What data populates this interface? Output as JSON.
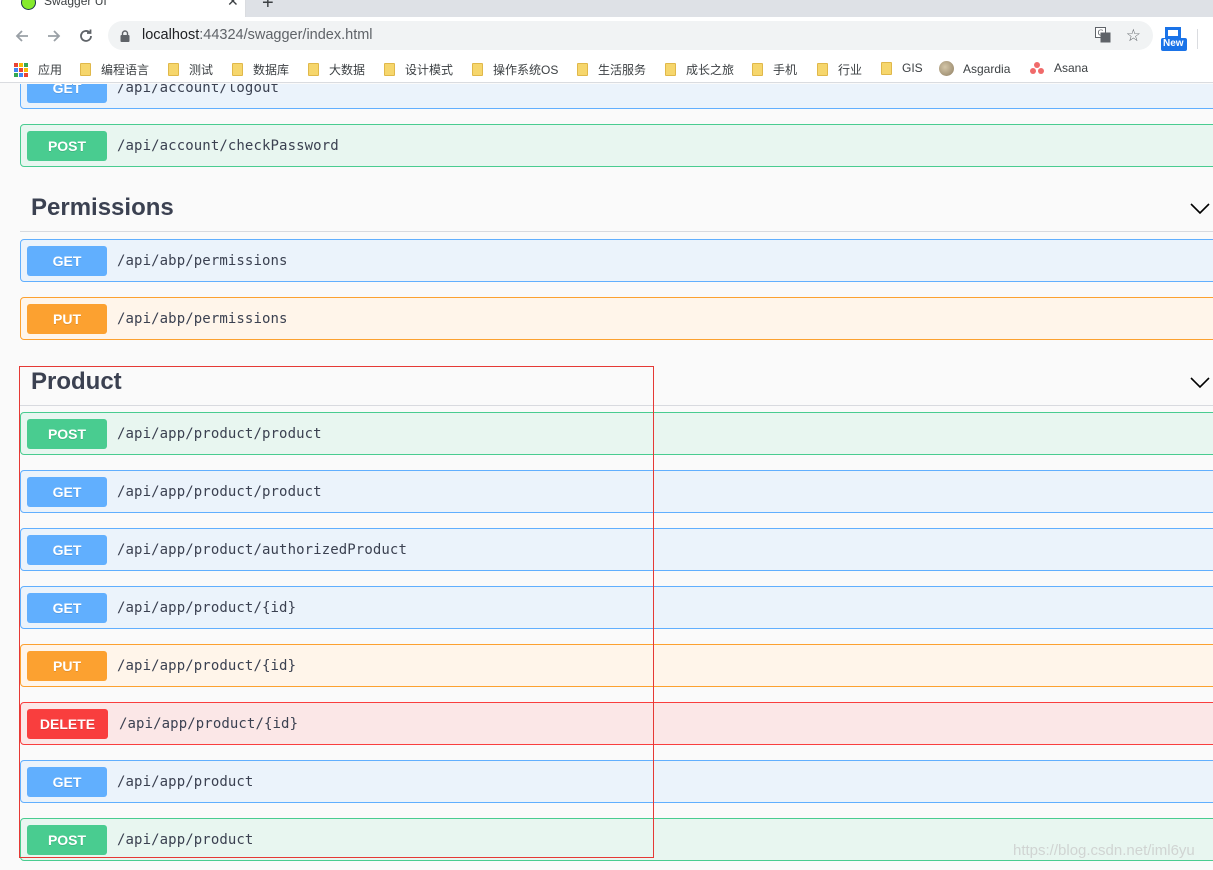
{
  "browser": {
    "tab_title": "Swagger UI",
    "url_host": "localhost",
    "url_rest": ":44324/swagger/index.html",
    "extension_badge": "New"
  },
  "bookmarks": [
    {
      "label": "应用",
      "icon": "apps-grid-icon"
    },
    {
      "label": "编程语言",
      "icon": "folder-icon"
    },
    {
      "label": "测试",
      "icon": "folder-icon"
    },
    {
      "label": "数据库",
      "icon": "folder-icon"
    },
    {
      "label": "大数据",
      "icon": "folder-icon"
    },
    {
      "label": "设计模式",
      "icon": "folder-icon"
    },
    {
      "label": "操作系统OS",
      "icon": "folder-icon"
    },
    {
      "label": "生活服务",
      "icon": "folder-icon"
    },
    {
      "label": "成长之旅",
      "icon": "folder-icon"
    },
    {
      "label": "手机",
      "icon": "folder-icon"
    },
    {
      "label": "行业",
      "icon": "folder-icon"
    },
    {
      "label": "GIS",
      "icon": "folder-icon"
    },
    {
      "label": "Asgardia",
      "icon": "globe-icon"
    },
    {
      "label": "Asana",
      "icon": "asana-icon"
    }
  ],
  "account_ops": [
    {
      "method": "GET",
      "path": "/api/account/logout"
    },
    {
      "method": "POST",
      "path": "/api/account/checkPassword"
    }
  ],
  "permissions": {
    "title": "Permissions",
    "ops": [
      {
        "method": "GET",
        "path": "/api/abp/permissions"
      },
      {
        "method": "PUT",
        "path": "/api/abp/permissions"
      }
    ]
  },
  "product": {
    "title": "Product",
    "ops": [
      {
        "method": "POST",
        "path": "/api/app/product/product"
      },
      {
        "method": "GET",
        "path": "/api/app/product/product"
      },
      {
        "method": "GET",
        "path": "/api/app/product/authorizedProduct"
      },
      {
        "method": "GET",
        "path": "/api/app/product/{id}"
      },
      {
        "method": "PUT",
        "path": "/api/app/product/{id}"
      },
      {
        "method": "DELETE",
        "path": "/api/app/product/{id}"
      },
      {
        "method": "GET",
        "path": "/api/app/product"
      },
      {
        "method": "POST",
        "path": "/api/app/product"
      }
    ]
  },
  "watermark": "https://blog.csdn.net/iml6yu",
  "colors": {
    "get": "#61affe",
    "post": "#49cc90",
    "put": "#fca130",
    "delete": "#f93e3e",
    "highlight": "#e53935"
  }
}
